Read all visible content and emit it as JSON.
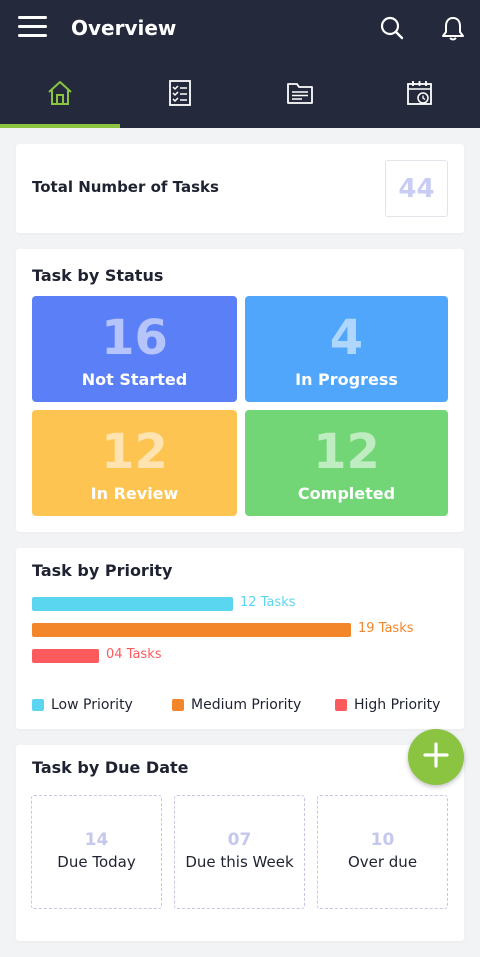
{
  "header": {
    "title": "Overview",
    "icons": [
      "menu-icon",
      "search-icon",
      "bell-icon"
    ]
  },
  "tabs": [
    {
      "icon": "home-icon",
      "active": true
    },
    {
      "icon": "checklist-icon",
      "active": false
    },
    {
      "icon": "folder-icon",
      "active": false
    },
    {
      "icon": "calendar-clock-icon",
      "active": false
    }
  ],
  "total": {
    "label": "Total Number of Tasks",
    "value": "44"
  },
  "status": {
    "title": "Task by Status",
    "items": [
      {
        "value": "16",
        "label": "Not Started",
        "color": "#5b7ff7"
      },
      {
        "value": "4",
        "label": "In Progress",
        "color": "#4fa6fb"
      },
      {
        "value": "12",
        "label": "In Review",
        "color": "#fec452"
      },
      {
        "value": "12",
        "label": "Completed",
        "color": "#72d677"
      }
    ]
  },
  "priority": {
    "title": "Task by Priority",
    "bars": [
      {
        "label": "12 Tasks",
        "value": 12,
        "color": "#5bd6f0"
      },
      {
        "label": "19 Tasks",
        "value": 19,
        "color": "#f4862a"
      },
      {
        "label": "04 Tasks",
        "value": 4,
        "color": "#fc5b5e"
      }
    ],
    "legend": [
      {
        "label": "Low Priority",
        "color": "#5bd6f0"
      },
      {
        "label": "Medium Priority",
        "color": "#f4862a"
      },
      {
        "label": "High Priority",
        "color": "#fc5b5e"
      }
    ]
  },
  "due": {
    "title": "Task by Due Date",
    "items": [
      {
        "value": "14",
        "label": "Due Today"
      },
      {
        "value": "07",
        "label": "Due this Week"
      },
      {
        "value": "10",
        "label": "Over due"
      }
    ]
  },
  "accent": "#8ac441",
  "fab_icon": "plus-icon"
}
